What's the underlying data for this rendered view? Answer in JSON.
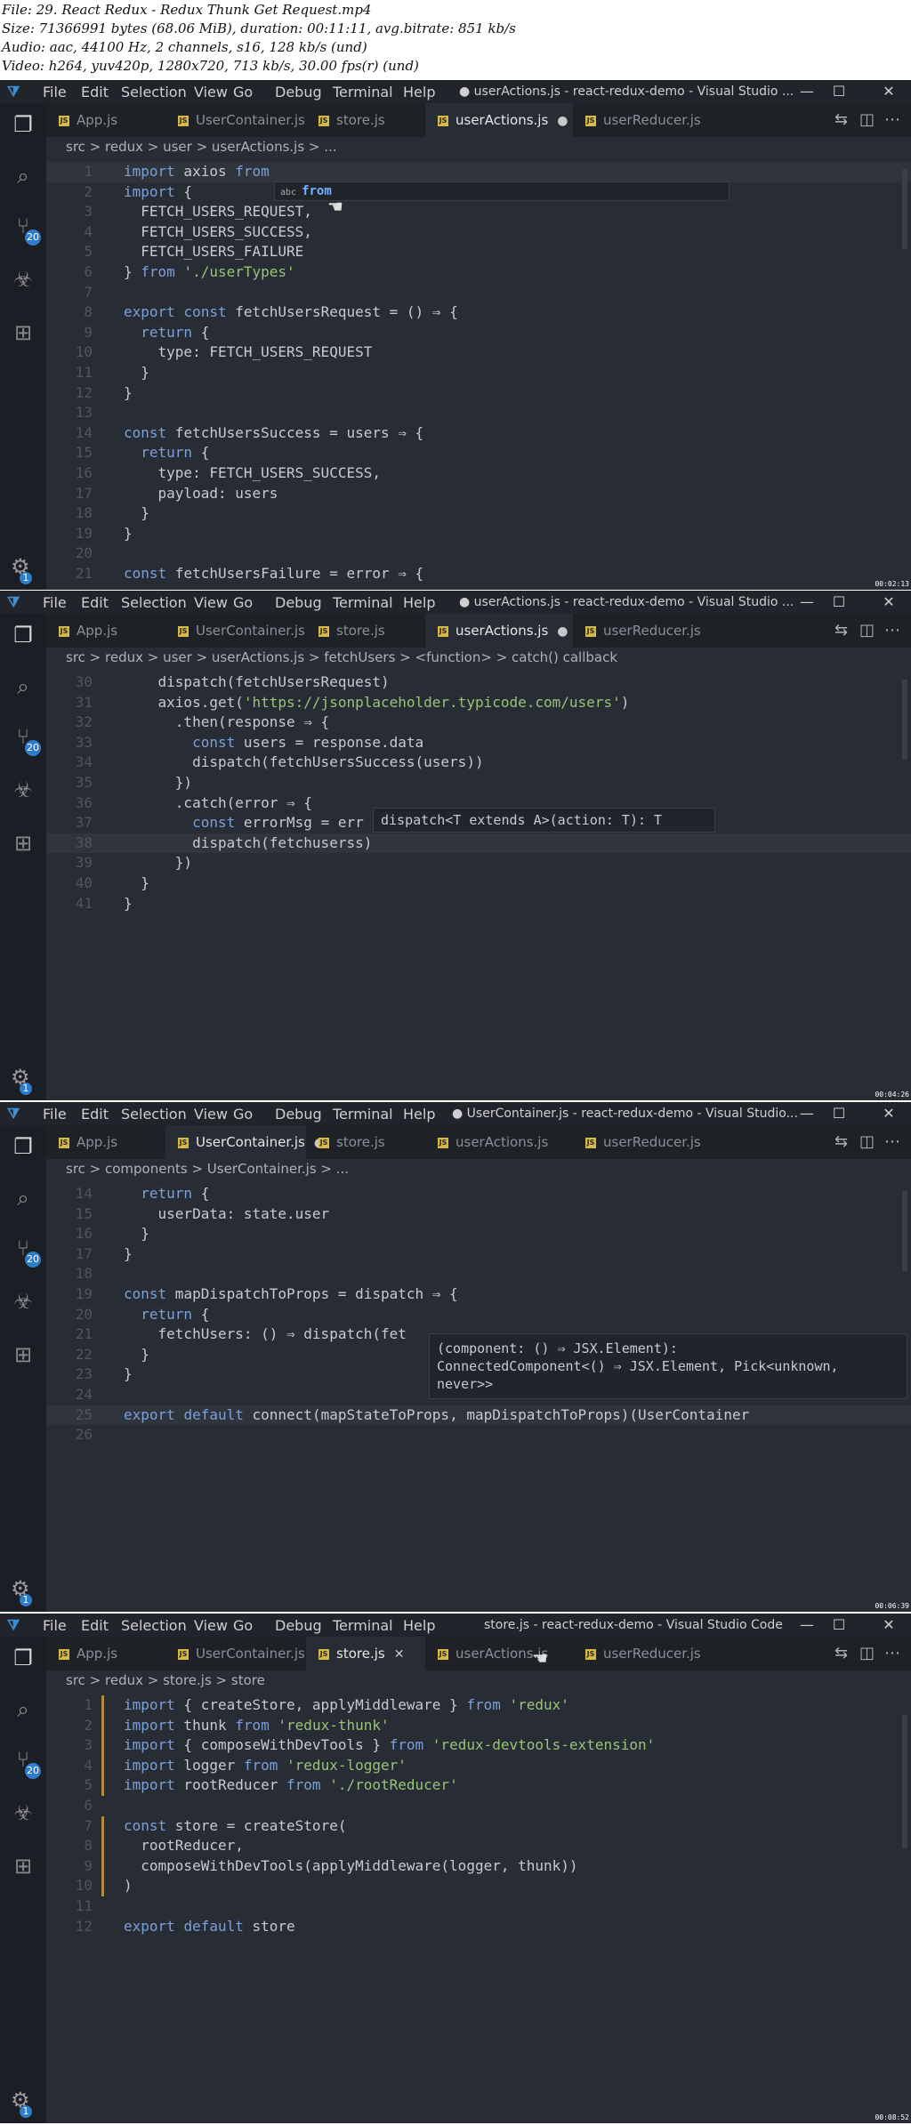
{
  "header": {
    "file": "File: 29. React Redux - Redux Thunk Get Request.mp4",
    "size": "Size: 71366991 bytes (68.06 MiB), duration: 00:11:11, avg.bitrate: 851 kb/s",
    "audio": "Audio: aac, 44100 Hz, 2 channels, s16, 128 kb/s (und)",
    "video": "Video: h264, yuv420p, 1280x720, 713 kb/s, 30.00 fps(r) (und)"
  },
  "menu": [
    "File",
    "Edit",
    "Selection",
    "View",
    "Go",
    "Debug",
    "Terminal",
    "Help"
  ],
  "tabs": [
    "App.js",
    "UserContainer.js",
    "store.js",
    "userActions.js",
    "userReducer.js"
  ],
  "frames": [
    {
      "title": "● userActions.js - react-redux-demo - Visual Studio ...",
      "active_tab": 3,
      "breadcrumb": "src  >  redux  >  user  >  userActions.js  >  ...",
      "timestamp": "00:02:13",
      "popup": "from",
      "popup_label": "abc",
      "lines": [
        {
          "n": "1",
          "t": "import axios from"
        },
        {
          "n": "2",
          "t": "import {"
        },
        {
          "n": "3",
          "t": "  FETCH_USERS_REQUEST,"
        },
        {
          "n": "4",
          "t": "  FETCH_USERS_SUCCESS,"
        },
        {
          "n": "5",
          "t": "  FETCH_USERS_FAILURE"
        },
        {
          "n": "6",
          "t": "} from './userTypes'"
        },
        {
          "n": "7",
          "t": ""
        },
        {
          "n": "8",
          "t": "export const fetchUsersRequest = () ⇒ {"
        },
        {
          "n": "9",
          "t": "  return {"
        },
        {
          "n": "10",
          "t": "    type: FETCH_USERS_REQUEST"
        },
        {
          "n": "11",
          "t": "  }"
        },
        {
          "n": "12",
          "t": "}"
        },
        {
          "n": "13",
          "t": ""
        },
        {
          "n": "14",
          "t": "const fetchUsersSuccess = users ⇒ {"
        },
        {
          "n": "15",
          "t": "  return {"
        },
        {
          "n": "16",
          "t": "    type: FETCH_USERS_SUCCESS,"
        },
        {
          "n": "17",
          "t": "    payload: users"
        },
        {
          "n": "18",
          "t": "  }"
        },
        {
          "n": "19",
          "t": "}"
        },
        {
          "n": "20",
          "t": ""
        },
        {
          "n": "21",
          "t": "const fetchUsersFailure = error ⇒ {"
        }
      ]
    },
    {
      "title": "● userActions.js - react-redux-demo - Visual Studio ...",
      "active_tab": 3,
      "breadcrumb": "src  >  redux  >  user  >  userActions.js  >  fetchUsers  >  <function>  >  catch() callback",
      "timestamp": "00:04:26",
      "popup": "dispatch<T extends A>(action: T): T",
      "lines": [
        {
          "n": "30",
          "t": "    dispatch(fetchUsersRequest)"
        },
        {
          "n": "31",
          "t": "    axios.get('https://jsonplaceholder.typicode.com/users')"
        },
        {
          "n": "32",
          "t": "      .then(response ⇒ {"
        },
        {
          "n": "33",
          "t": "        const users = response.data"
        },
        {
          "n": "34",
          "t": "        dispatch(fetchUsersSuccess(users))"
        },
        {
          "n": "35",
          "t": "      })"
        },
        {
          "n": "36",
          "t": "      .catch(error ⇒ {"
        },
        {
          "n": "37",
          "t": "        const errorMsg = err"
        },
        {
          "n": "38",
          "t": "        dispatch(fetchuserss)"
        },
        {
          "n": "39",
          "t": "      })"
        },
        {
          "n": "40",
          "t": "  }"
        },
        {
          "n": "41",
          "t": "}"
        }
      ]
    },
    {
      "title": "● UserContainer.js - react-redux-demo - Visual Studio...",
      "active_tab": 1,
      "breadcrumb": "src  >  components  >  UserContainer.js  >  ...",
      "timestamp": "00:06:39",
      "popup": "(component: () ⇒ JSX.Element):\nConnectedComponent<() ⇒ JSX.Element, Pick<unknown,\nnever>>",
      "lines": [
        {
          "n": "14",
          "t": "  return {"
        },
        {
          "n": "15",
          "t": "    userData: state.user"
        },
        {
          "n": "16",
          "t": "  }"
        },
        {
          "n": "17",
          "t": "}"
        },
        {
          "n": "18",
          "t": ""
        },
        {
          "n": "19",
          "t": "const mapDispatchToProps = dispatch ⇒ {"
        },
        {
          "n": "20",
          "t": "  return {"
        },
        {
          "n": "21",
          "t": "    fetchUsers: () ⇒ dispatch(fet"
        },
        {
          "n": "22",
          "t": "  }"
        },
        {
          "n": "23",
          "t": "}"
        },
        {
          "n": "24",
          "t": ""
        },
        {
          "n": "25",
          "t": "export default connect(mapStateToProps, mapDispatchToProps)(UserContainer"
        },
        {
          "n": "26",
          "t": ""
        }
      ]
    },
    {
      "title": "store.js - react-redux-demo - Visual Studio Code",
      "active_tab": 2,
      "breadcrumb": "src  >  redux  >  store.js  >  store",
      "timestamp": "00:08:52",
      "lines": [
        {
          "n": "1",
          "t": "import { createStore, applyMiddleware } from 'redux'"
        },
        {
          "n": "2",
          "t": "import thunk from 'redux-thunk'"
        },
        {
          "n": "3",
          "t": "import { composeWithDevTools } from 'redux-devtools-extension'"
        },
        {
          "n": "4",
          "t": "import logger from 'redux-logger'"
        },
        {
          "n": "5",
          "t": "import rootReducer from './rootReducer'"
        },
        {
          "n": "6",
          "t": ""
        },
        {
          "n": "7",
          "t": "const store = createStore("
        },
        {
          "n": "8",
          "t": "  rootReducer,"
        },
        {
          "n": "9",
          "t": "  composeWithDevTools(applyMiddleware(logger, thunk))"
        },
        {
          "n": "10",
          "t": ")"
        },
        {
          "n": "11",
          "t": ""
        },
        {
          "n": "12",
          "t": "export default store"
        }
      ]
    }
  ],
  "badges": {
    "git": "20",
    "settings": "1"
  },
  "colors": {
    "editor_bg": "#282c34",
    "activity_bg": "#1b1e24",
    "accent": "#2f7cc9"
  }
}
